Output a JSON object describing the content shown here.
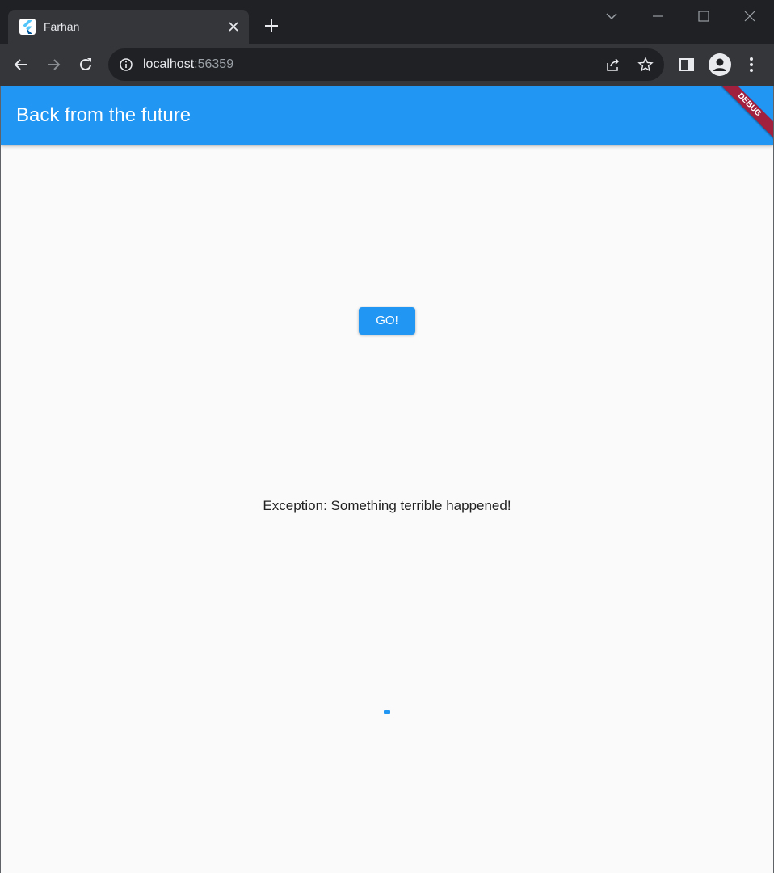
{
  "browser": {
    "tab": {
      "title": "Farhan",
      "favicon": "flutter-icon"
    },
    "address": {
      "host": "localhost",
      "port": ":56359"
    },
    "icons": {
      "back": "arrow-left-icon",
      "forward": "arrow-right-icon",
      "reload": "reload-icon",
      "info": "info-icon",
      "share": "share-icon",
      "bookmark": "star-icon",
      "sidepanel": "side-panel-icon",
      "profile": "profile-icon",
      "menu": "kebab-menu-icon"
    }
  },
  "app": {
    "title": "Back from the future",
    "debug_banner": "DEBUG",
    "button_label": "GO!",
    "result_text": "Exception: Something terrible happened!",
    "colors": {
      "primary": "#2196f3",
      "banner": "#a0203e",
      "background": "#fafafa"
    }
  }
}
